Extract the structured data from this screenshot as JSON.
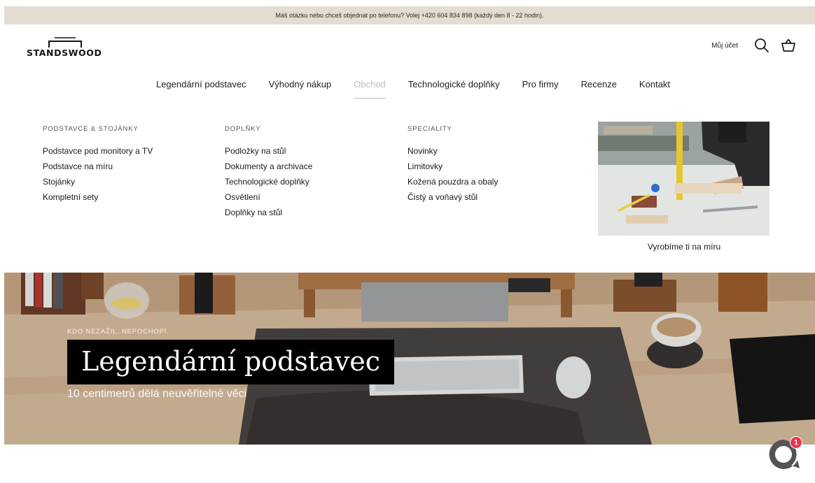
{
  "announcement": {
    "text": "Máš otázku nebo chceš objednat po telefonu? Volej +420 604 834 898 (každý den 8 - 22 hodin)."
  },
  "header": {
    "logo_text": "STANDSWOOD",
    "account_label": "Můj účet",
    "search_icon": "search-icon",
    "cart_icon": "cart-icon"
  },
  "nav": {
    "items": [
      {
        "label": "Legendární podstavec"
      },
      {
        "label": "Výhodný nákup"
      },
      {
        "label": "Obchod",
        "active": true
      },
      {
        "label": "Technologické doplňky"
      },
      {
        "label": "Pro firmy"
      },
      {
        "label": "Recenze"
      },
      {
        "label": "Kontakt"
      }
    ]
  },
  "mega_menu": {
    "columns": [
      {
        "heading": "PODSTAVCE & STOJÁNKY",
        "links": [
          "Podstavce pod monitory a TV",
          "Podstavce na míru",
          "Stojánky",
          "Kompletní sety"
        ]
      },
      {
        "heading": "DOPLŇKY",
        "links": [
          "Podložky na stůl",
          "Dokumenty a archivace",
          "Technologické doplňky",
          "Osvětlení",
          "Doplňky na stůl"
        ]
      },
      {
        "heading": "SPECIALITY",
        "links": [
          "Novinky",
          "Limitovky",
          "Kožená pouzdra a obaly",
          "Čistý a voňavý stůl"
        ]
      }
    ],
    "promo": {
      "caption": "Vyrobíme ti na míru"
    }
  },
  "hero": {
    "tagline": "KDO NEZAŽIL, NEPOCHOPÍ.",
    "title": "Legendární podstavec",
    "subtitle": "10 centimetrů dělá neuvěřitelné věci"
  },
  "chat": {
    "badge_count": "1",
    "icon": "chat-icon"
  },
  "colors": {
    "announcement_bg": "#e4dcd1",
    "nav_active": "#c2bcb4",
    "badge": "#e8384f"
  }
}
